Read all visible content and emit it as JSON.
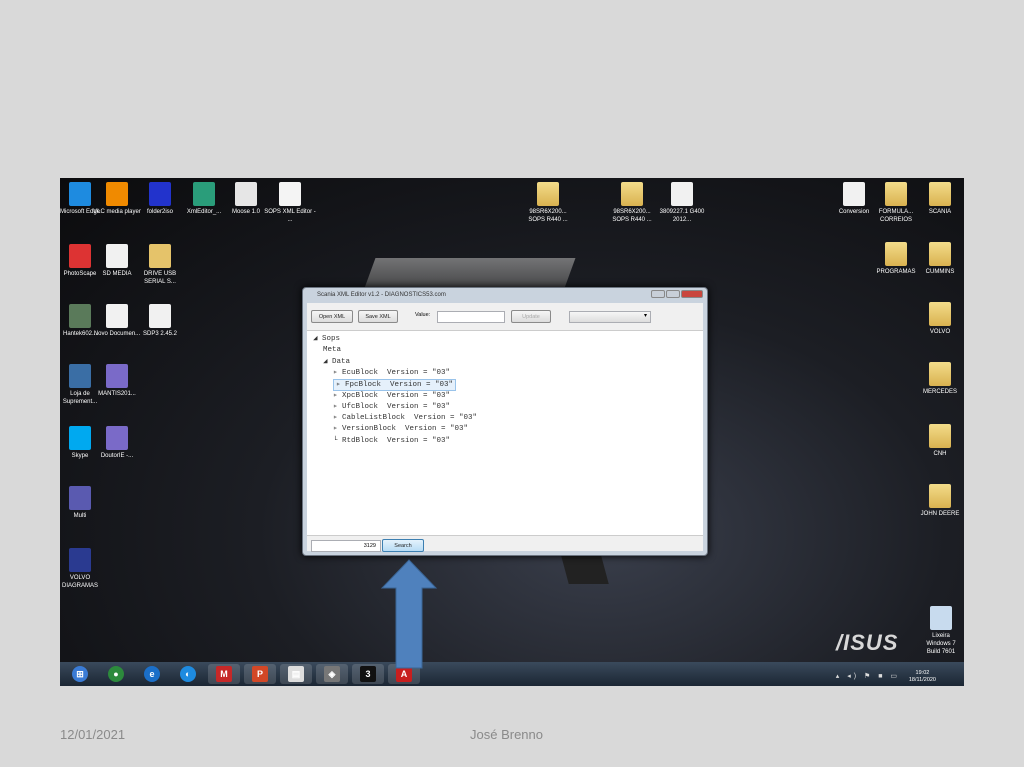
{
  "slide": {
    "date": "12/01/2021",
    "author": "José Brenno"
  },
  "desktop": {
    "left_icons": [
      {
        "label": "Microsoft Edge",
        "icon": "edge-icon",
        "color": "#1e8be0"
      },
      {
        "label": "VLC media player",
        "icon": "vlc-icon",
        "color": "#f08a00"
      },
      {
        "label": "folder2iso",
        "icon": "folder2iso-icon",
        "color": "#2233cc"
      },
      {
        "label": "XmlEditor_...",
        "icon": "xmleditor-icon",
        "color": "#2a9d7a"
      },
      {
        "label": "Moose 1.0",
        "icon": "moose-icon",
        "color": "#e6e6e6"
      },
      {
        "label": "SOPS XML Editor - ...",
        "icon": "sops-xml-icon",
        "color": "#f4f4f4"
      },
      {
        "label": "PhotoScape",
        "icon": "photoscape-icon",
        "color": "#d33"
      },
      {
        "label": "SD MEDIA",
        "icon": "file-icon",
        "color": "#f1f1f1"
      },
      {
        "label": "DRIVE USB SERIAL S...",
        "icon": "pdf-folder-icon",
        "color": "#e5c36a"
      },
      {
        "label": "Hantek602...",
        "icon": "monitor-icon",
        "color": "#5a7a5a"
      },
      {
        "label": "Novo Documen...",
        "icon": "file-icon",
        "color": "#f1f1f1"
      },
      {
        "label": "SDP3 2.45.2",
        "icon": "file-icon",
        "color": "#f1f1f1"
      },
      {
        "label": "Loja de Suprement...",
        "icon": "store-icon",
        "color": "#3a6ea5"
      },
      {
        "label": "MANTIS201...",
        "icon": "disc-file-icon",
        "color": "#7a6ac8"
      },
      {
        "label": "Skype",
        "icon": "skype-icon",
        "color": "#00a9f0"
      },
      {
        "label": "DoutorIE -...",
        "icon": "disc-file-icon",
        "color": "#7a6ac8"
      },
      {
        "label": "Multi",
        "icon": "tools-icon",
        "color": "#5a5ab0"
      },
      {
        "label": "VOLVO DIAGRAMAS",
        "icon": "volvo-icon",
        "color": "#2a3a90"
      }
    ],
    "top_icons": [
      {
        "label": "98SR6X200... SOPS R440 ...",
        "icon": "folder-icon"
      },
      {
        "label": "98SR6X200... SOPS R440 ...",
        "icon": "folder-icon"
      },
      {
        "label": "3809227.1 G400 2012...",
        "icon": "file-icon"
      }
    ],
    "right_icons": [
      {
        "label": "Conversion",
        "icon": "pdf-icon"
      },
      {
        "label": "FORMULA... CORREIOS",
        "icon": "folder-icon"
      },
      {
        "label": "SCANIA",
        "icon": "folder-icon"
      },
      {
        "label": "PROGRAMAS",
        "icon": "folder-icon"
      },
      {
        "label": "CUMMINS",
        "icon": "folder-icon"
      },
      {
        "label": "VOLVO",
        "icon": "folder-icon"
      },
      {
        "label": "MERCEDES",
        "icon": "folder-icon"
      },
      {
        "label": "CNH",
        "icon": "folder-icon"
      },
      {
        "label": "JOHN DEERE",
        "icon": "folder-icon"
      }
    ],
    "recycle_bin": {
      "label": "Lixeira"
    },
    "watermark": {
      "line1": "Windows 7",
      "line2": "Build 7601"
    },
    "brand": "/ISUS"
  },
  "window": {
    "title": "Scania XML Editor v1.2 - DIAGNOSTICS53.com",
    "open_label": "Open XML",
    "save_label": "Save XML",
    "value_label": "Value:",
    "value": "",
    "update_label": "Update",
    "dropdown_value": "",
    "tree": [
      {
        "text": "◢ Sops",
        "depth": 0
      },
      {
        "text": "Meta",
        "depth": 1
      },
      {
        "text": "◢ Data",
        "depth": 1
      },
      {
        "text": "▹ EcuBlock  Version = \"03\"",
        "depth": 2
      },
      {
        "text": "▹ FpcBlock  Version = \"03\"",
        "depth": 2,
        "selected": true
      },
      {
        "text": "▹ XpcBlock  Version = \"03\"",
        "depth": 2
      },
      {
        "text": "▹ UfcBlock  Version = \"03\"",
        "depth": 2
      },
      {
        "text": "▹ CableListBlock  Version = \"03\"",
        "depth": 2
      },
      {
        "text": "▹ VersionBlock  Version = \"03\"",
        "depth": 2
      },
      {
        "text": "└ RtdBlock  Version = \"03\"",
        "depth": 2
      }
    ],
    "search_value": "3129",
    "search_label": "Search"
  },
  "taskbar": {
    "items": [
      {
        "name": "start",
        "color": "#3a7bd5",
        "glyph": "⊞"
      },
      {
        "name": "chrome",
        "color": "#2c8a3c",
        "glyph": "●"
      },
      {
        "name": "internet-explorer",
        "color": "#1b6fc8",
        "glyph": "e"
      },
      {
        "name": "edge",
        "color": "#1e8be0",
        "glyph": "◐"
      },
      {
        "name": "mcafee",
        "color": "#c62828",
        "glyph": "M"
      },
      {
        "name": "powerpoint",
        "color": "#d24726",
        "glyph": "P"
      },
      {
        "name": "document",
        "color": "#dddddd",
        "glyph": "▤"
      },
      {
        "name": "device",
        "color": "#777777",
        "glyph": "◈"
      },
      {
        "name": "sdp3",
        "color": "#111111",
        "glyph": "3"
      },
      {
        "name": "acrobat",
        "color": "#c81e1e",
        "glyph": "A"
      }
    ],
    "time": "19:02",
    "date": "18/11/2020"
  },
  "colors": {
    "arrow": "#4f81bd",
    "slide_bg": "#d9d9d9"
  }
}
